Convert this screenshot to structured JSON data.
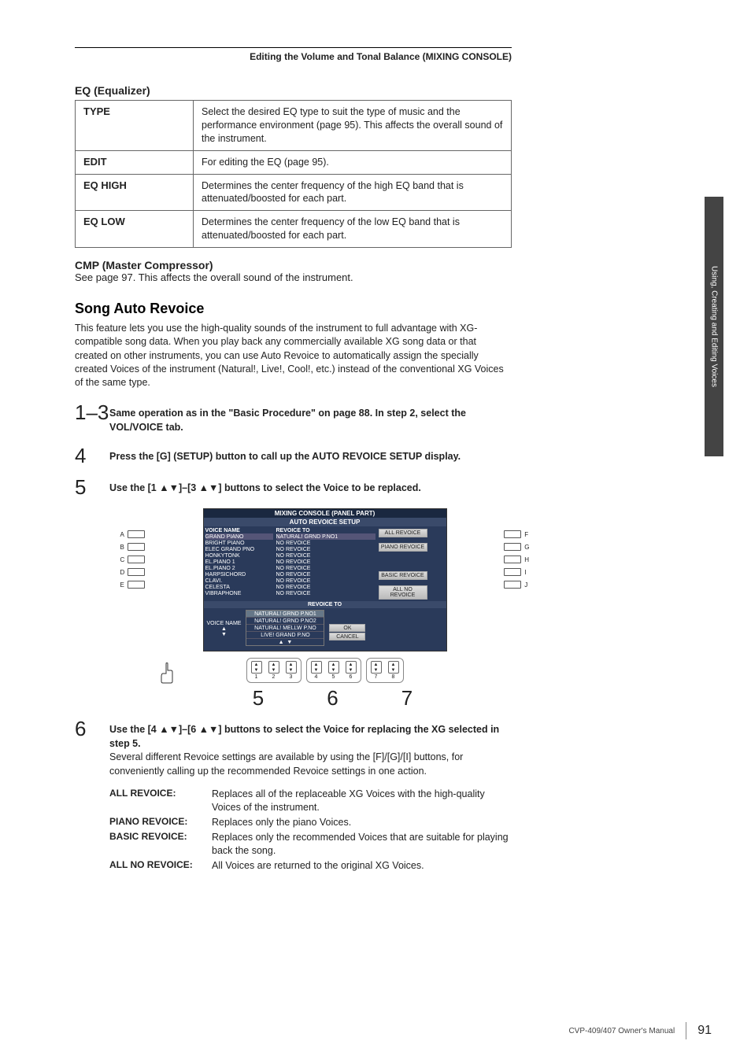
{
  "header": {
    "title": "Editing the Volume and Tonal Balance (MIXING CONSOLE)"
  },
  "eq": {
    "heading": "EQ (Equalizer)",
    "rows": [
      {
        "label": "TYPE",
        "desc": "Select the desired EQ type to suit the type of music and the performance environment (page 95). This affects the overall sound of the instrument."
      },
      {
        "label": "EDIT",
        "desc": "For editing the EQ (page 95)."
      },
      {
        "label": "EQ HIGH",
        "desc": "Determines the center frequency of the high EQ band that is attenuated/boosted for each part."
      },
      {
        "label": "EQ LOW",
        "desc": "Determines the center frequency of the low EQ band that is attenuated/boosted for each part."
      }
    ]
  },
  "cmp": {
    "title": "CMP (Master Compressor)",
    "desc": "See page 97. This affects the overall sound of the instrument."
  },
  "section": {
    "title": "Song Auto Revoice",
    "desc": "This feature lets you use the high-quality sounds of the instrument to full advantage with XG-compatible song data. When you play back any commercially available XG song data or that created on other instruments, you can use Auto Revoice to automatically assign the specially created Voices of the instrument (Natural!, Live!, Cool!, etc.) instead of the conventional XG Voices of the same type."
  },
  "steps": {
    "s1": {
      "num": "1–3",
      "text": "Same operation as in the \"Basic Procedure\" on page 88. In step 2, select the VOL/VOICE tab."
    },
    "s4": {
      "num": "4",
      "text": "Press the [G] (SETUP) button to call up the AUTO REVOICE SETUP display."
    },
    "s5": {
      "num": "5",
      "text": "Use the [1 ▲▼]–[3 ▲▼] buttons to select the Voice to be replaced."
    },
    "s6": {
      "num": "6",
      "bold": "Use the [4 ▲▼]–[6 ▲▼] buttons to select the Voice for replacing the XG selected in step 5.",
      "reg": "Several different Revoice settings are available by using the [F]/[G]/[I] buttons, for conveniently calling up the recommended Revoice settings in one action."
    }
  },
  "screen": {
    "title": "MIXING CONSOLE (PANEL PART)",
    "sub": "AUTO REVOICE SETUP",
    "col1": "VOICE NAME",
    "col2": "REVOICE TO",
    "voices": [
      {
        "name": "GRAND PIANO",
        "to": "NATURAL! GRND P.NO1",
        "hl": true
      },
      {
        "name": "BRIGHT PIANO",
        "to": "NO REVOICE"
      },
      {
        "name": "ELEC GRAND PNO",
        "to": "NO REVOICE"
      },
      {
        "name": "HONKYTONK",
        "to": "NO REVOICE"
      },
      {
        "name": "EL.PIANO 1",
        "to": "NO REVOICE"
      },
      {
        "name": "EL.PIANO 2",
        "to": "NO REVOICE"
      },
      {
        "name": "HARPSICHORD",
        "to": "NO REVOICE"
      },
      {
        "name": "CLAVI.",
        "to": "NO REVOICE"
      },
      {
        "name": "CELESTA",
        "to": "NO REVOICE"
      },
      {
        "name": "VIBRAPHONE",
        "to": "NO REVOICE"
      }
    ],
    "side_btns": [
      {
        "label": "ALL REVOICE"
      },
      {
        "label": "PIANO REVOICE"
      },
      {
        "label": "BASIC REVOICE"
      },
      {
        "label": "ALL NO REVOICE"
      }
    ],
    "revoice_to_bar": "REVOICE TO",
    "voice_name_lbl": "VOICE NAME",
    "opts": [
      "NATURAL! GRND P.NO1",
      "NATURAL! GRND P.NO2",
      "NATURAL! MELLW P.NO",
      "LIVE! GRAND P.NO"
    ],
    "ok": "OK",
    "cancel": "CANCEL",
    "left_labels": [
      "A",
      "B",
      "C",
      "D",
      "E"
    ],
    "right_labels": [
      "F",
      "G",
      "H",
      "I",
      "J"
    ],
    "bottom_nums": [
      "1",
      "2",
      "3",
      "4",
      "5",
      "6",
      "7",
      "8"
    ]
  },
  "big_nums": [
    "5",
    "6",
    "7"
  ],
  "revoice_defs": [
    {
      "term": "ALL REVOICE:",
      "desc": "Replaces all of the replaceable XG Voices with the high-quality Voices of the instrument."
    },
    {
      "term": "PIANO REVOICE:",
      "desc": "Replaces only the piano Voices."
    },
    {
      "term": "BASIC REVOICE:",
      "desc": "Replaces only the recommended Voices that are suitable for playing back the song."
    },
    {
      "term": "ALL NO REVOICE:",
      "desc": "All Voices are returned to the original XG Voices."
    }
  ],
  "tab": {
    "text": "Using, Creating and Editing Voices"
  },
  "footer": {
    "manual": "CVP-409/407 Owner's Manual",
    "page": "91"
  }
}
